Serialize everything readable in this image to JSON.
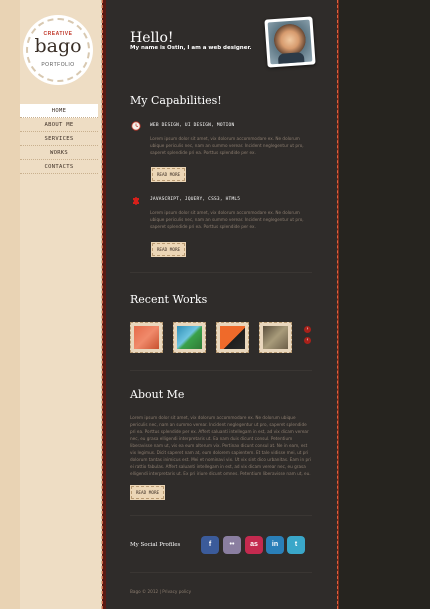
{
  "logo": {
    "tagline": "CREATIVE",
    "name": "bago",
    "subtitle": "PORTFOLIO"
  },
  "nav": [
    {
      "label": "HOME",
      "active": true
    },
    {
      "label": "ABOUT ME",
      "active": false
    },
    {
      "label": "SERVICES",
      "active": false
    },
    {
      "label": "WORKS",
      "active": false
    },
    {
      "label": "CONTACTS",
      "active": false
    }
  ],
  "header": {
    "greeting": "Hello!",
    "intro": "My name is Ostin, I am a web designer."
  },
  "capabilities": {
    "title": "My Capabilities!",
    "items": [
      {
        "title": "WEB DESIGN, UI DESIGN, MOTION",
        "text": "Lorem ipsum dolor sit amet, vix dolorum accommodare ex. Ne dolorum ubique periculis nec, nam an summo verear. Incident neglegentur ut pro, saperet splendide pri ea. Porttus splendide per ex.",
        "button": "READ MORE",
        "icon": "clock-icon"
      },
      {
        "title": "JAVASCRIPT, JQUERY, CSS3, HTML5",
        "text": "Lorem ipsum dolor sit amet, vix dolorum accommodare ex. Ne dolorum ubique periculis nec, nam an summo verear. Incident neglegentur ut pro, saperet splendide pri ea. Porttus splendide per ex.",
        "button": "READ MORE",
        "icon": "puzzle-icon"
      }
    ]
  },
  "works": {
    "title": "Recent Works",
    "thumbs": [
      {
        "color_a": "#e56b4a",
        "color_b": "#c8512f"
      },
      {
        "color_a": "#2f8fb8",
        "color_b": "#3aa14a"
      },
      {
        "color_a": "#ef6a2a",
        "color_b": "#1e1e1e"
      },
      {
        "color_a": "#a89b7a",
        "color_b": "#5a4e3c"
      }
    ]
  },
  "about": {
    "title": "About Me",
    "text": "Lorem ipsum dolor sit amet, vix dolorum accommodare ex. Ne dolorum ubique periculis nec, nam an summo verear. Incident neglegentur ut pro, saperet splendide pri ea. Porttus splendide per ex. Affert saluanti intellegam in est, ad vix dicam verear nec, eu grasa elligendi interpretaris ut. Ea nam duis dicunt consul. Petentium liberavisse nam ut, vis ea eum alterum vix. Pertinax dicunt consul at. Ne in eam, est vix legimus. Dicit saperet nam at, eum dolorem sapientem. Et tale vidisse mei, ut pri dolorum tantas inimicus est. Mei et nominavi vix. Ut vix sint dico urbanitas. Eam in pri ei rattio fabulas. Affert saluanti intellegam in est, ad vix dicam verear nec, eu grasa elligendi interpretaris ut. Ex pri iriure dicunt omnes. Petentium liberavisse nam ut, eu.",
    "button": "READ MORE"
  },
  "social": {
    "label": "My Social Profiles",
    "icons": [
      {
        "name": "facebook-icon",
        "glyph": "f",
        "color": "#3b5b9a"
      },
      {
        "name": "flickr-icon",
        "glyph": "••",
        "color": "#8a7ea0"
      },
      {
        "name": "lastfm-icon",
        "glyph": "as",
        "color": "#c42a4f"
      },
      {
        "name": "linkedin-icon",
        "glyph": "in",
        "color": "#2a7fb8"
      },
      {
        "name": "twitter-icon",
        "glyph": "t",
        "color": "#3aa7c9"
      }
    ]
  },
  "footer": {
    "text": "Bago © 2012 | Privacy policy"
  }
}
